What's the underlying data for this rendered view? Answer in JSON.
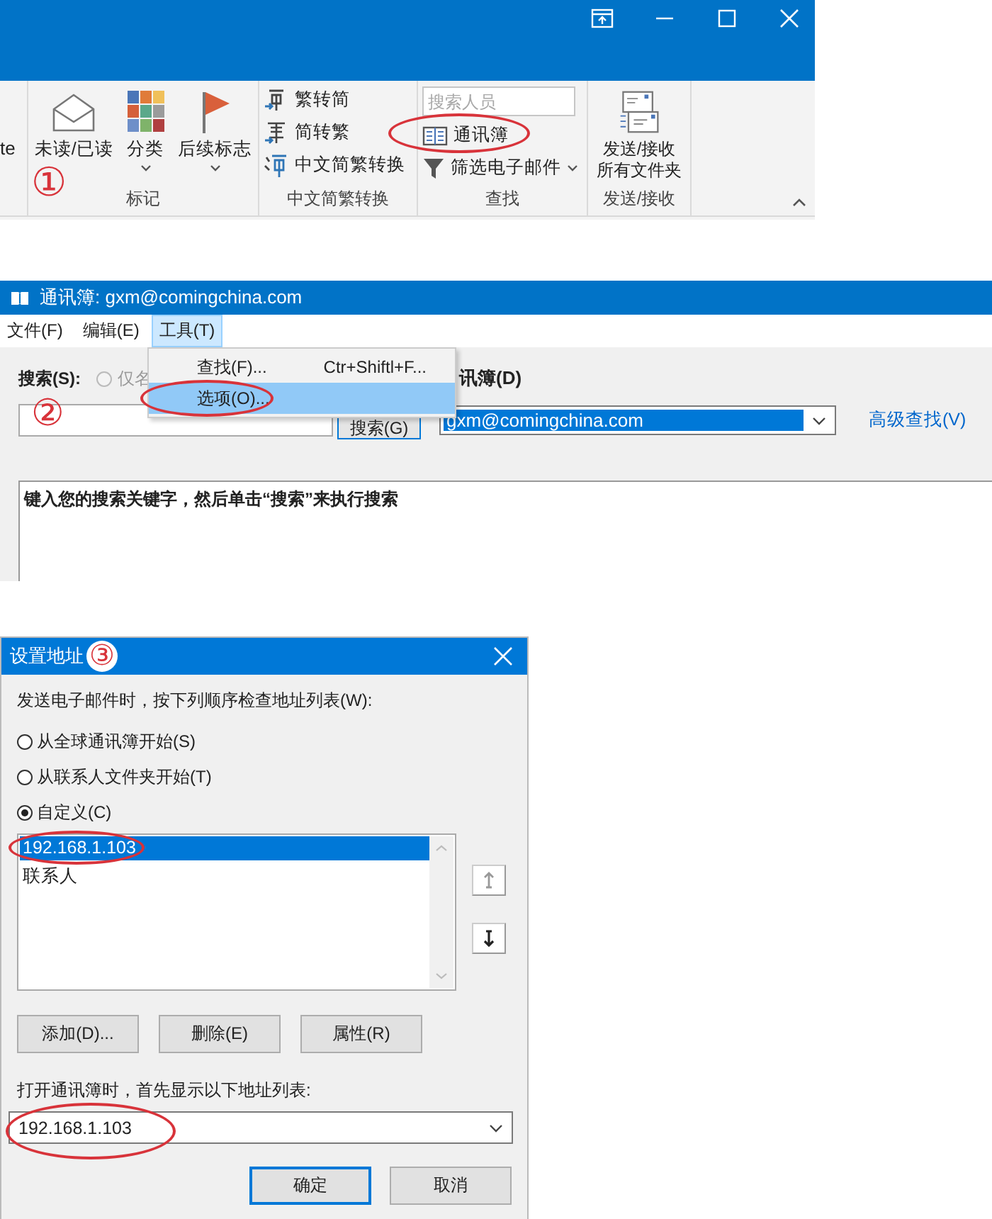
{
  "outlook_ribbon": {
    "cut_label": "te",
    "step": "①",
    "groups": [
      {
        "label": "标记",
        "items": [
          {
            "kind": "large",
            "label": "未读/已读",
            "dropdown": false
          },
          {
            "kind": "large",
            "label": "分类",
            "dropdown": true
          },
          {
            "kind": "large",
            "label": "后续标志",
            "dropdown": true
          }
        ]
      },
      {
        "label": "中文简繁转换",
        "items": [
          {
            "kind": "small",
            "label": "繁转简",
            "dropdown": false
          },
          {
            "kind": "small",
            "label": "简转繁",
            "dropdown": false
          },
          {
            "kind": "small",
            "label": "中文简繁转换",
            "dropdown": false
          }
        ]
      },
      {
        "label": "查找",
        "items": [
          {
            "kind": "search",
            "placeholder": "搜索人员"
          },
          {
            "kind": "small",
            "label": "通讯簿",
            "dropdown": false,
            "circled": true
          },
          {
            "kind": "small",
            "label": "筛选电子邮件",
            "dropdown": true
          }
        ]
      },
      {
        "label": "发送/接收",
        "items": [
          {
            "kind": "large",
            "label": "发送/接收所有文件夹",
            "dropdown": false
          }
        ]
      }
    ]
  },
  "address_book": {
    "title": "通讯簿: gxm@comingchina.com",
    "step": "②",
    "menu": [
      {
        "label": "文件(F)",
        "selected": false
      },
      {
        "label": "编辑(E)",
        "selected": false
      },
      {
        "label": "工具(T)",
        "selected": true
      }
    ],
    "menu_dropdown": [
      {
        "label": "查找(F)...",
        "shortcut": "Ctr+Shiftl+F...",
        "selected": false
      },
      {
        "label": "选项(O)...",
        "selected": true,
        "circled": true
      }
    ],
    "search_label": "搜索(S):",
    "name_only_radio": {
      "label": "仅名",
      "disabled": true
    },
    "search_button": "搜索(G)",
    "address_book_label": "讯簿(D)",
    "address_book_value": "gxm@comingchina.com",
    "advanced_link": "高级查找(V)",
    "results_hint": "键入您的搜索关键字，然后单击“搜索”来执行搜索"
  },
  "address_dialog": {
    "title": "设置地址",
    "step": "③",
    "order_label": "发送电子邮件时，按下列顺序检查地址列表(W):",
    "radios": [
      {
        "label": "从全球通讯簿开始(S)",
        "selected": false
      },
      {
        "label": "从联系人文件夹开始(T)",
        "selected": false
      },
      {
        "label": "自定义(C)",
        "selected": true
      }
    ],
    "lists": [
      {
        "label": "192.168.1.103",
        "selected": true,
        "circled": true
      },
      {
        "label": "联系人",
        "selected": false,
        "circled": false
      }
    ],
    "list_buttons": [
      "添加(D)...",
      "删除(E)",
      "属性(R)"
    ],
    "startup_label": "打开通讯簿时，首先显示以下地址列表:",
    "startup_value": "192.168.1.103",
    "startup_circled": true,
    "footer_buttons": [
      {
        "label": "确定",
        "default": true
      },
      {
        "label": "取消",
        "default": false
      }
    ]
  }
}
